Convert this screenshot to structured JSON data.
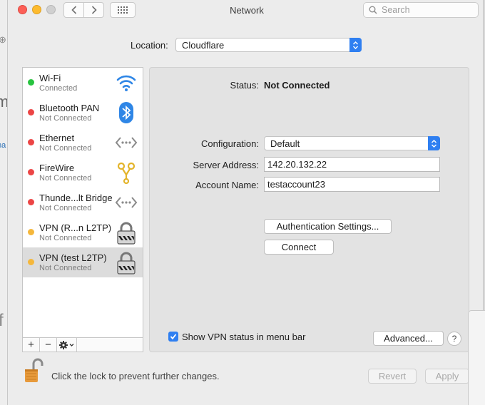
{
  "window": {
    "title": "Network"
  },
  "search": {
    "placeholder": "Search"
  },
  "location": {
    "label": "Location:",
    "value": "Cloudflare"
  },
  "services": [
    {
      "name": "Wi-Fi",
      "status": "Connected",
      "dot_color": "#27c33f",
      "icon": "wifi-icon"
    },
    {
      "name": "Bluetooth PAN",
      "status": "Not Connected",
      "dot_color": "#ec4545",
      "icon": "bluetooth-icon"
    },
    {
      "name": "Ethernet",
      "status": "Not Connected",
      "dot_color": "#ec4545",
      "icon": "ethernet-icon"
    },
    {
      "name": "FireWire",
      "status": "Not Connected",
      "dot_color": "#ec4545",
      "icon": "firewire-icon"
    },
    {
      "name": "Thunde...lt Bridge",
      "status": "Not Connected",
      "dot_color": "#ec4545",
      "icon": "thunderbolt-bridge-icon"
    },
    {
      "name": "VPN (R...n L2TP)",
      "status": "Not Connected",
      "dot_color": "#f5b73b",
      "icon": "vpn-lock-icon"
    },
    {
      "name": "VPN (test L2TP)",
      "status": "Not Connected",
      "dot_color": "#f5b73b",
      "icon": "vpn-lock-icon",
      "selected": true
    }
  ],
  "list_controls": {
    "add": "+",
    "remove": "−",
    "gear": "gear-menu-icon"
  },
  "detail": {
    "status_label": "Status:",
    "status_value": "Not Connected",
    "configuration_label": "Configuration:",
    "configuration_value": "Default",
    "server_address_label": "Server Address:",
    "server_address_value": "142.20.132.22",
    "account_name_label": "Account Name:",
    "account_name_value": "testaccount23",
    "auth_settings_button": "Authentication Settings...",
    "connect_button": "Connect",
    "show_vpn_status_label": "Show VPN status in menu bar",
    "show_vpn_status_checked": true,
    "advanced_button": "Advanced...",
    "help_button": "?"
  },
  "footer": {
    "lock_text": "Click the lock to prevent further changes.",
    "revert_button": "Revert",
    "apply_button": "Apply"
  },
  "background_fragments": [
    "m",
    "na",
    "f"
  ],
  "colors": {
    "accent": "#2f7ff1",
    "connected": "#27c33f",
    "not_connected": "#ec4545",
    "vpn_pending": "#f5b73b"
  }
}
